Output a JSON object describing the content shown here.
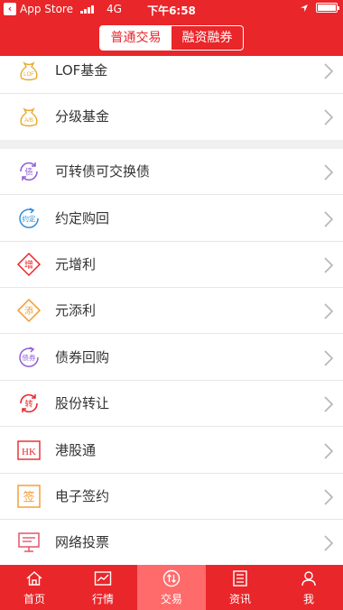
{
  "status_bar": {
    "back_label": "App Store",
    "network": "4G",
    "time": "下午6:58"
  },
  "segment": {
    "tab1": "普通交易",
    "tab2": "融资融券"
  },
  "list": [
    {
      "label": "LOF基金",
      "icon": "lof-fund-icon",
      "badge": "LOF"
    },
    {
      "label": "分级基金",
      "icon": "graded-fund-icon",
      "badge": "A/B"
    },
    {
      "label": "可转债可交换债",
      "icon": "convertible-bond-icon",
      "badge": "债"
    },
    {
      "label": "约定购回",
      "icon": "agreed-repurchase-icon",
      "badge": "约定"
    },
    {
      "label": "元增利",
      "icon": "yuan-zengli-icon",
      "badge": "增"
    },
    {
      "label": "元添利",
      "icon": "yuan-tianli-icon",
      "badge": "添"
    },
    {
      "label": "债券回购",
      "icon": "bond-repo-icon",
      "badge": "债券"
    },
    {
      "label": "股份转让",
      "icon": "share-transfer-icon",
      "badge": "转"
    },
    {
      "label": "港股通",
      "icon": "hk-connect-icon",
      "badge": "HK"
    },
    {
      "label": "电子签约",
      "icon": "e-sign-icon",
      "badge": "签"
    },
    {
      "label": "网络投票",
      "icon": "online-vote-icon",
      "badge": ""
    }
  ],
  "tabbar": [
    {
      "label": "首页",
      "icon": "home-icon"
    },
    {
      "label": "行情",
      "icon": "market-chart-icon"
    },
    {
      "label": "交易",
      "icon": "trade-icon"
    },
    {
      "label": "资讯",
      "icon": "news-icon"
    },
    {
      "label": "我",
      "icon": "profile-icon"
    }
  ],
  "colors": {
    "brand": "#e9262a",
    "active_tab": "#ff6b6b",
    "gold": "#e8a92a",
    "purple": "#8f5fd6",
    "red": "#e9262a",
    "orange": "#f39a2c",
    "pink": "#e0566b"
  }
}
